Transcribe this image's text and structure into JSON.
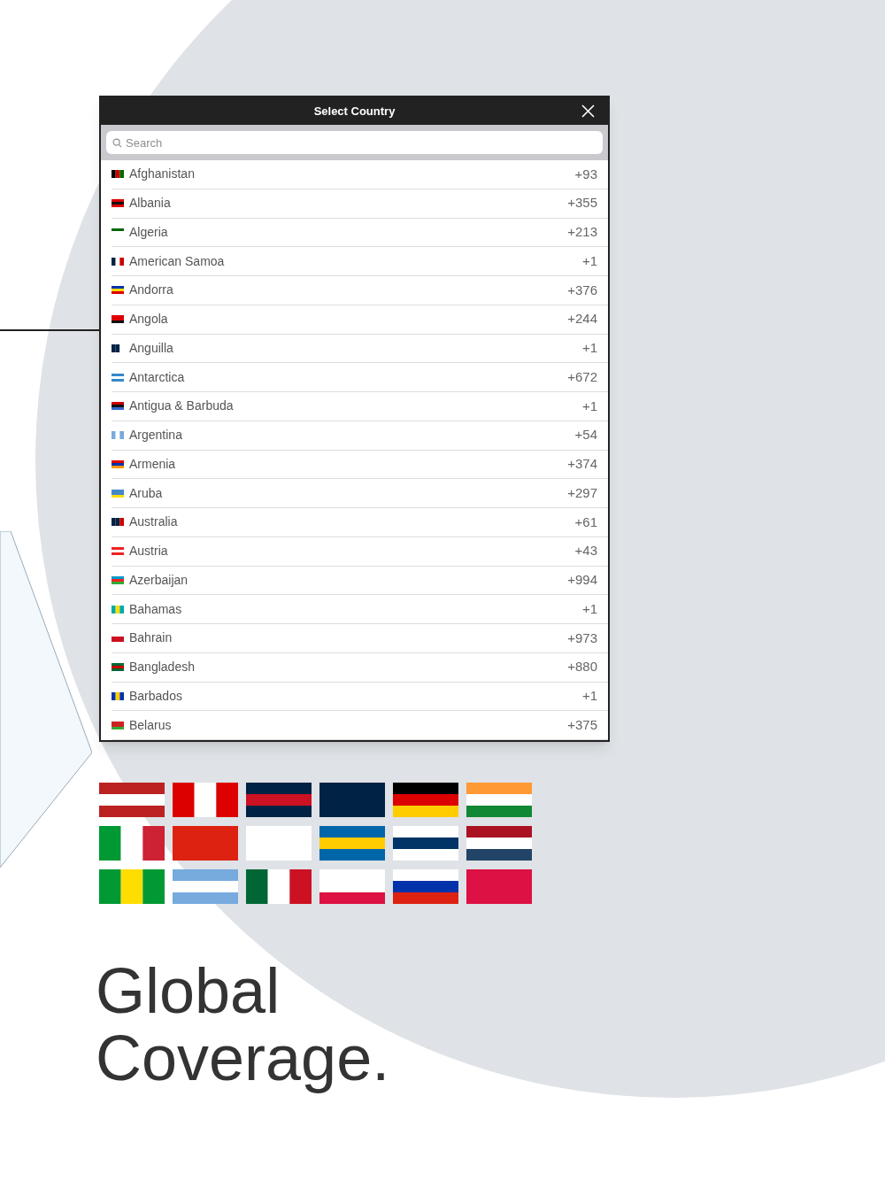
{
  "dialog": {
    "title": "Select Country",
    "search": {
      "placeholder": "Search"
    },
    "countries": [
      {
        "name": "Afghanistan",
        "code": "+93"
      },
      {
        "name": "Albania",
        "code": "+355"
      },
      {
        "name": "Algeria",
        "code": "+213"
      },
      {
        "name": "American Samoa",
        "code": "+1"
      },
      {
        "name": "Andorra",
        "code": "+376"
      },
      {
        "name": "Angola",
        "code": "+244"
      },
      {
        "name": "Anguilla",
        "code": "+1"
      },
      {
        "name": "Antarctica",
        "code": "+672"
      },
      {
        "name": "Antigua & Barbuda",
        "code": "+1"
      },
      {
        "name": "Argentina",
        "code": "+54"
      },
      {
        "name": "Armenia",
        "code": "+374"
      },
      {
        "name": "Aruba",
        "code": "+297"
      },
      {
        "name": "Australia",
        "code": "+61"
      },
      {
        "name": "Austria",
        "code": "+43"
      },
      {
        "name": "Azerbaijan",
        "code": "+994"
      },
      {
        "name": "Bahamas",
        "code": "+1"
      },
      {
        "name": "Bahrain",
        "code": "+973"
      },
      {
        "name": "Bangladesh",
        "code": "+880"
      },
      {
        "name": "Barbados",
        "code": "+1"
      },
      {
        "name": "Belarus",
        "code": "+375"
      }
    ]
  },
  "headline": [
    "Global",
    "Coverage."
  ]
}
